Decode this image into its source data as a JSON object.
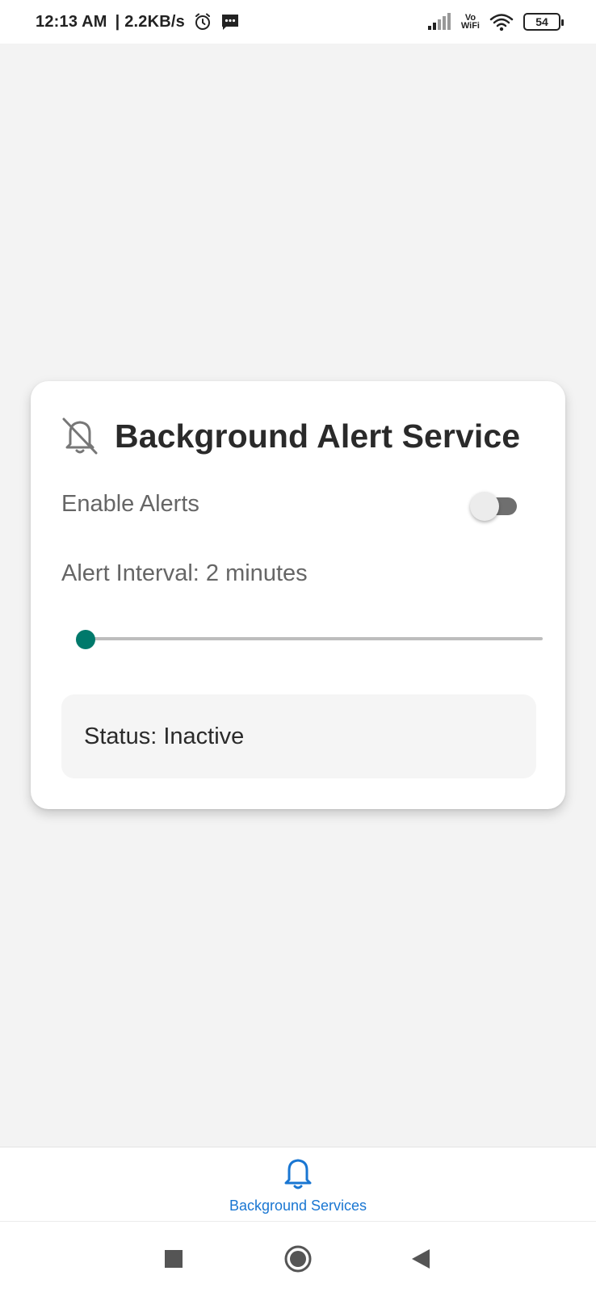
{
  "status_bar": {
    "time": "12:13 AM",
    "network_speed": "| 2.2KB/s",
    "vowifi_top": "Vo",
    "vowifi_bottom": "WiFi",
    "battery": "54",
    "icons": [
      "alarm-icon",
      "message-icon",
      "signal-icon",
      "wifi-icon",
      "battery-icon"
    ]
  },
  "card": {
    "icon": "bell-off-icon",
    "title": "Background Alert Service",
    "enable_label": "Enable Alerts",
    "enable_toggle_on": false,
    "interval_label": "Alert Interval: 2 minutes",
    "interval_slider_fraction": 0,
    "status_text": "Status: Inactive"
  },
  "bottom_nav": {
    "items": [
      {
        "label": "Background Services",
        "icon": "bell-icon",
        "active": true
      }
    ]
  },
  "system_nav": {
    "buttons": [
      "recent-apps",
      "home",
      "back"
    ]
  },
  "colors": {
    "accent": "#00796b",
    "nav_active": "#1976d2",
    "background": "#f3f3f3"
  }
}
